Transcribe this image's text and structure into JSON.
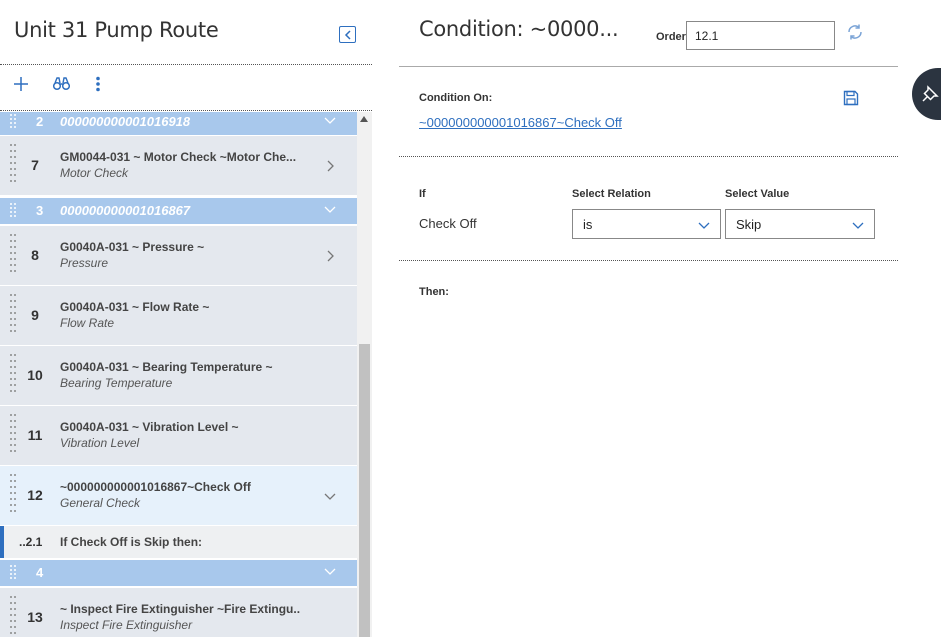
{
  "left_panel": {
    "title": "Unit 31 Pump Route",
    "toolbar": {
      "add_icon": "plus-icon",
      "find_icon": "binoculars-icon",
      "more_icon": "kebab-icon"
    }
  },
  "groups": [
    {
      "num": "2",
      "title": "000000000001016918"
    },
    {
      "num": "3",
      "title": "000000000001016867"
    },
    {
      "num": "4",
      "title": ""
    }
  ],
  "rows": [
    {
      "num": "7",
      "line1": "GM0044-031 ~ Motor Check ~Motor Che...",
      "line2": "Motor Check"
    },
    {
      "num": "8",
      "line1": "G0040A-031 ~ Pressure ~",
      "line2": "Pressure"
    },
    {
      "num": "9",
      "line1": "G0040A-031 ~ Flow Rate ~",
      "line2": "Flow Rate"
    },
    {
      "num": "10",
      "line1": "G0040A-031 ~ Bearing Temperature ~",
      "line2": "Bearing Temperature"
    },
    {
      "num": "11",
      "line1": "G0040A-031 ~ Vibration Level ~",
      "line2": "Vibration Level"
    },
    {
      "num": "12",
      "line1": "~000000000001016867~Check Off",
      "line2": "General Check"
    },
    {
      "num": "13",
      "line1": "~ Inspect Fire Extinguisher ~Fire Extingu...",
      "line2": "Inspect Fire Extinguisher"
    }
  ],
  "condition_row": {
    "num": "..2.1",
    "text": "If Check Off is Skip then:"
  },
  "right_panel": {
    "title": "Condition: ~0000...",
    "order_label": "Order",
    "order_value": "12.1",
    "condition_on_label": "Condition On:",
    "condition_on_link": "~000000000001016867~Check Off",
    "if_label": "If",
    "relation_label": "Select Relation",
    "value_label": "Select Value",
    "if_field": "Check Off",
    "relation_value": "is",
    "value_value": "Skip",
    "then_label": "Then:"
  },
  "colors": {
    "accent": "#2e6fbf",
    "group_header": "#a8c8ec",
    "row_bg": "#e4e8ee",
    "row_highlight": "#e6f1fb"
  }
}
